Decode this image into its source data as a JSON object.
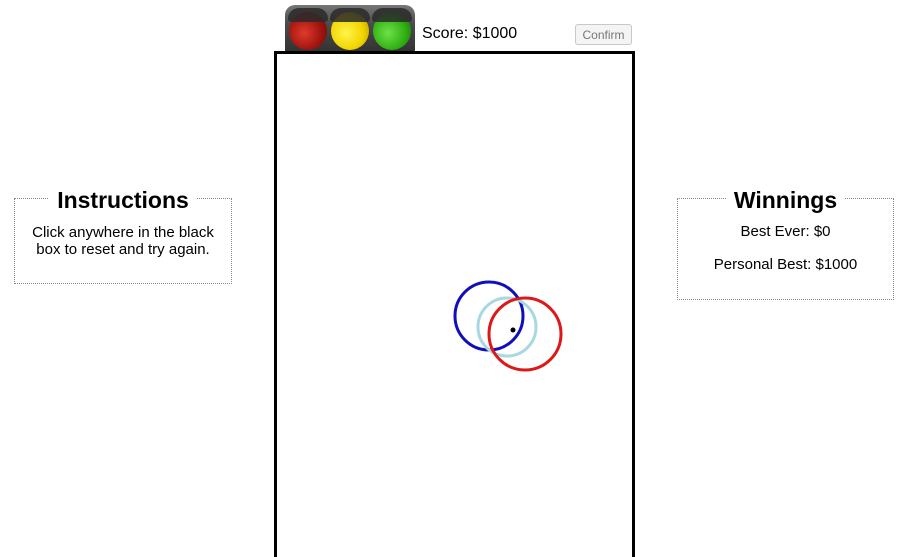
{
  "header": {
    "score_text": "Score: $1000",
    "confirm_label": "Confirm"
  },
  "traffic_light": {
    "lights": [
      "red",
      "yellow",
      "green"
    ],
    "colors": {
      "red": "#b01a12",
      "yellow": "#f2d400",
      "green": "#32b012"
    }
  },
  "instructions": {
    "title": "Instructions",
    "line1": "Click anywhere in the black",
    "line2": "box to reset and try again."
  },
  "winnings": {
    "title": "Winnings",
    "best_ever": "Best Ever: $0",
    "personal_best": "Personal Best: $1000"
  },
  "game": {
    "circle_colors": {
      "blue": "#1010bb",
      "light_blue": "#a8d8e0",
      "red": "#dd1818"
    }
  }
}
